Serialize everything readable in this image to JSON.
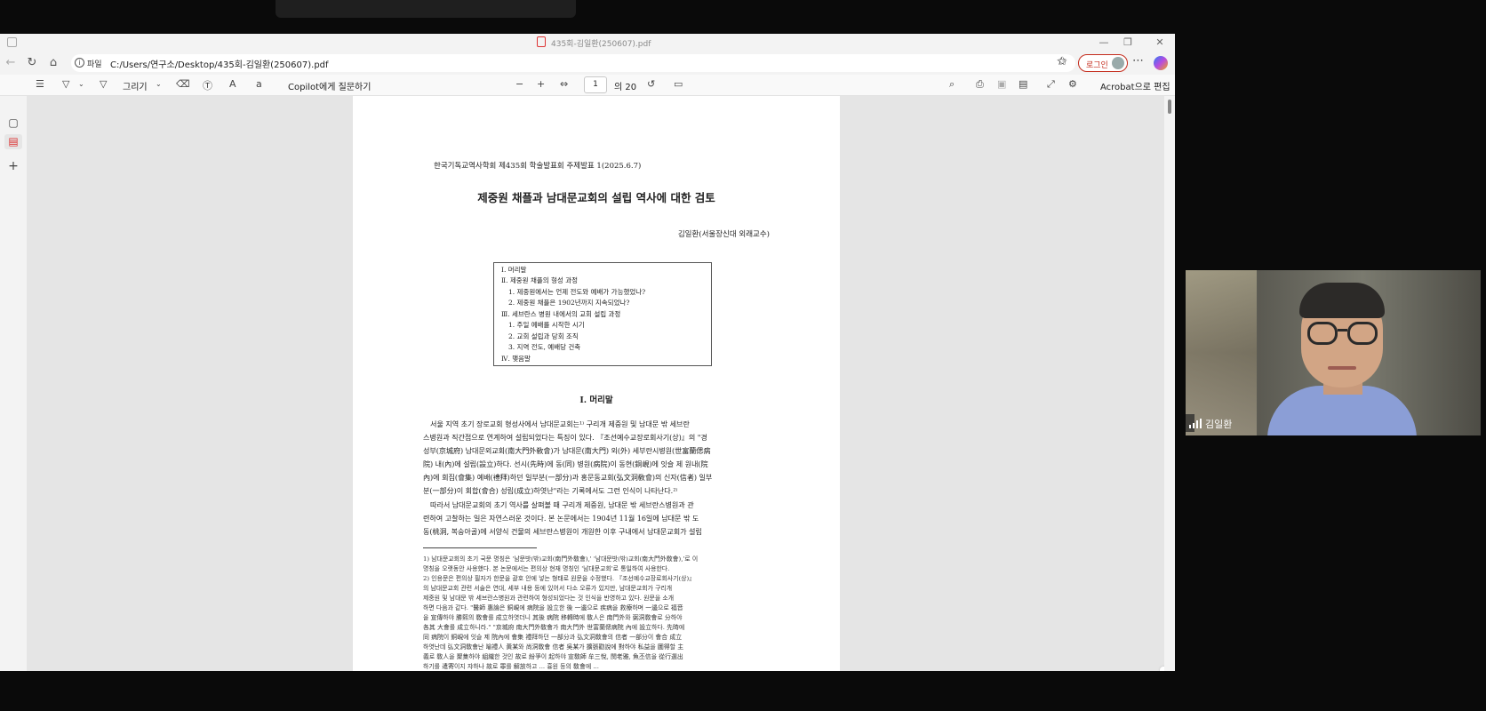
{
  "window": {
    "tab_title": "435회-김일환(250607).pdf",
    "minimize": "—",
    "restore": "❐",
    "close": "✕"
  },
  "addressbar": {
    "scheme_label": "파일",
    "url": "C:/Users/연구소/Desktop/435회-김일환(250607).pdf",
    "login_label": "로그인",
    "more": "⋯"
  },
  "pdf_toolbar": {
    "draw_label": "그리기",
    "copilot_label": "Copilot에게 질문하기",
    "page_current": "1",
    "page_total": "의 20",
    "acrobat_label": "Acrobat으로 편집"
  },
  "document": {
    "header": "한국기독교역사학회 제435회 학술발표회 주제발표 1(2025.6.7)",
    "title": "제중원 채플과 남대문교회의 설립 역사에 대한 검토",
    "author": "김일환(서울장신대 외래교수)",
    "toc": [
      "Ⅰ. 머리말",
      "Ⅱ. 제중원 채플의 형성 과정",
      "1. 제중원에서는 언제 전도와 예배가 가능했었나?",
      "2. 제중원 채플은 1902년까지 지속되었나?",
      "Ⅲ. 세브란스 병원 내에서의 교회 설립 과정",
      "1. 주일 예배를 시작한 시기",
      "2. 교회 설립과 당회 조직",
      "3. 지역 전도, 예배당 건축",
      "Ⅳ. 맺음말"
    ],
    "section_title": "Ⅰ. 머리말",
    "body": [
      "　서울 지역 초기 장로교회 형성사에서 남대문교회는¹⁾ 구리개 제중원 및 남대문 밖 세브란",
      "스병원과 직간접으로 연계하여 설립되었다는 특징이 있다. 『조선예수교장로회사기(상)』의 \"경",
      "성부(京城府) 남대문외교회(南大門外敎會)가 남대문(南大門) 외(外) 세부란시병원(世富蘭偲病",
      "院) 내(內)에 설립(設立)하다. 선시(先時)에 동(同) 병원(病院)이 동현(銅峴)에 잇슬 제 원내(院",
      "內)에 회집(會集) 예배(禮拜)하던 일부분(一部分)과 홍문동교회(弘文洞敎會)의 신자(信者) 일부",
      "분(一部分)이 회합(會合) 성립(成立)하엿난\"라는 기록에서도 그런 인식이 나타난다.²⁾",
      "　따라서 남대문교회의 초기 역사를 살펴볼 때 구리개 제중원, 남대문 밖 세브란스병원과 관",
      "련하여 고찰하는 일은 자연스러운 것이다. 본 논문에서는 1904년 11월 16일에 남대문 밖 도",
      "동(桃洞, 복숭아골)에 서양식 건물의 세브란스병원이 개원한 이후 구내에서 남대문교회가 설립"
    ],
    "footnotes": [
      "1) 남대문교회의 초기 국문 명칭은 '남문밧(밖)교회(南門外敎會),' '남대문밧(밖)교회(南大門外敎會),'로 이",
      "    명칭을 오랫동안 사용했다. 본 논문에서는 편의상 현재 명칭인 '남대문교회'로 통일하여 사용한다.",
      "2) 인용문은 편의상 필자가 한문을 괄호 안에 넣는 형태로 원문을 수정했다. 『조선예수교장로회사기(상)』",
      "    의 남대문교회 관련 서술은 연대, 세부 내용 등에 있어서 다소 오류가 있지만, 남대문교회가 구리개",
      "    제중원 및 남대문 밖 세브란스병원과 관련하여 형성되었다는 것 인식을 반영하고 있다. 원문을 소개",
      "    하면 다음과 같다. \"醫師 惠論은 銅峴에 病院을 設立한 後 一邊으로 疾病을 救療하며 一邊으로 福音",
      "    을 宣傳하야 勝熙의 敎會를 成立하엿더니 其後 病院 移轉時에 敎人은 南門外와 弼洞敎會로 分하야",
      "    各其 大會를 成立하니라.\" \"京城府 南大門外敎會가 南大門外 世富蘭偲病院 內에 設立하다. 先時에",
      "    同 病院이 銅峴에 잇슬 제 院內에 會集 禮拜하던 一部分과 弘文洞敎會의 信者 一部分이 會合 成立",
      "    하엿난데 弘文洞敎會난 喻禮人 黃某와 尚洞敎會 信者 吳某가 擴張勸說에 對하야 私益을 圖得할 主",
      "    義로 敎人을 聚集하야 組織한 것인 故로 紛爭이 起하야 宣敎師 牟三悅, 閔老雅, 魚丕信을 從行選出",
      "    하기를 遣寄이지 쟈하나 故로 罪를 解放하고 ... 흉원 등의 敎會에 ..."
    ]
  },
  "video": {
    "participant_name": "김일환"
  }
}
